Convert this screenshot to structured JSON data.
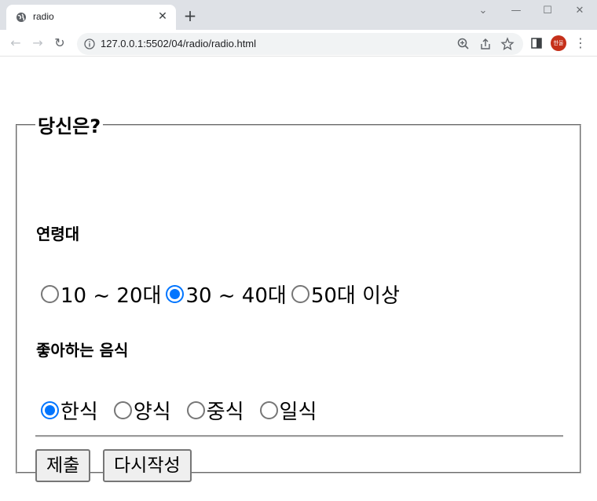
{
  "browser": {
    "tab_title": "radio",
    "tab_close_glyph": "✕",
    "new_tab_glyph": "+",
    "url": "127.0.0.1:5502/04/radio/radio.html",
    "profile_initials": "한울",
    "window_controls": {
      "collapse": "⌄",
      "minimize": "—",
      "maximize": "☐",
      "close": "✕"
    },
    "nav": {
      "back": "←",
      "forward": "→",
      "reload": "↻"
    },
    "menu_glyph": "⋮"
  },
  "form": {
    "legend": "당신은?",
    "age_group": {
      "label": "연령대",
      "options": [
        {
          "label": "10 ~ 20대",
          "checked": false
        },
        {
          "label": "30 ~ 40대",
          "checked": true
        },
        {
          "label": "50대 이상",
          "checked": false
        }
      ]
    },
    "food": {
      "label": "좋아하는 음식",
      "options": [
        {
          "label": "한식",
          "checked": true
        },
        {
          "label": "양식",
          "checked": false
        },
        {
          "label": "중식",
          "checked": false
        },
        {
          "label": "일식",
          "checked": false
        }
      ]
    },
    "submit_label": "제출",
    "reset_label": "다시작성"
  },
  "colors": {
    "accent": "#0075ff",
    "radio_border": "#767676",
    "tabbar_bg": "#dee1e6",
    "omnibox_bg": "#f1f3f4",
    "avatar_bg": "#c5301a"
  }
}
